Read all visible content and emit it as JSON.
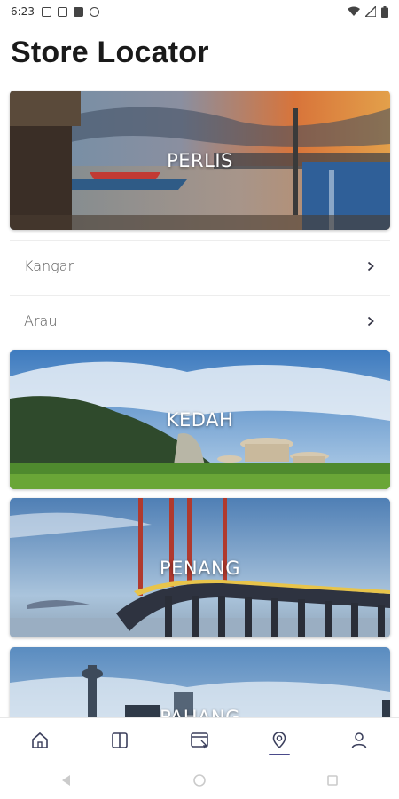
{
  "status_bar": {
    "time": "6:23"
  },
  "page_title": "Store Locator",
  "states": [
    {
      "name": "PERLIS"
    },
    {
      "name": "KEDAH"
    },
    {
      "name": "PENANG"
    },
    {
      "name": "PAHANG"
    }
  ],
  "cities": [
    {
      "name": "Kangar"
    },
    {
      "name": "Arau"
    }
  ],
  "bottom_nav": [
    {
      "icon": "home-icon",
      "active": false
    },
    {
      "icon": "catalog-icon",
      "active": false
    },
    {
      "icon": "promo-icon",
      "active": false
    },
    {
      "icon": "location-icon",
      "active": true
    },
    {
      "icon": "profile-icon",
      "active": false
    }
  ],
  "colors": {
    "accent": "#4a4a8a"
  }
}
